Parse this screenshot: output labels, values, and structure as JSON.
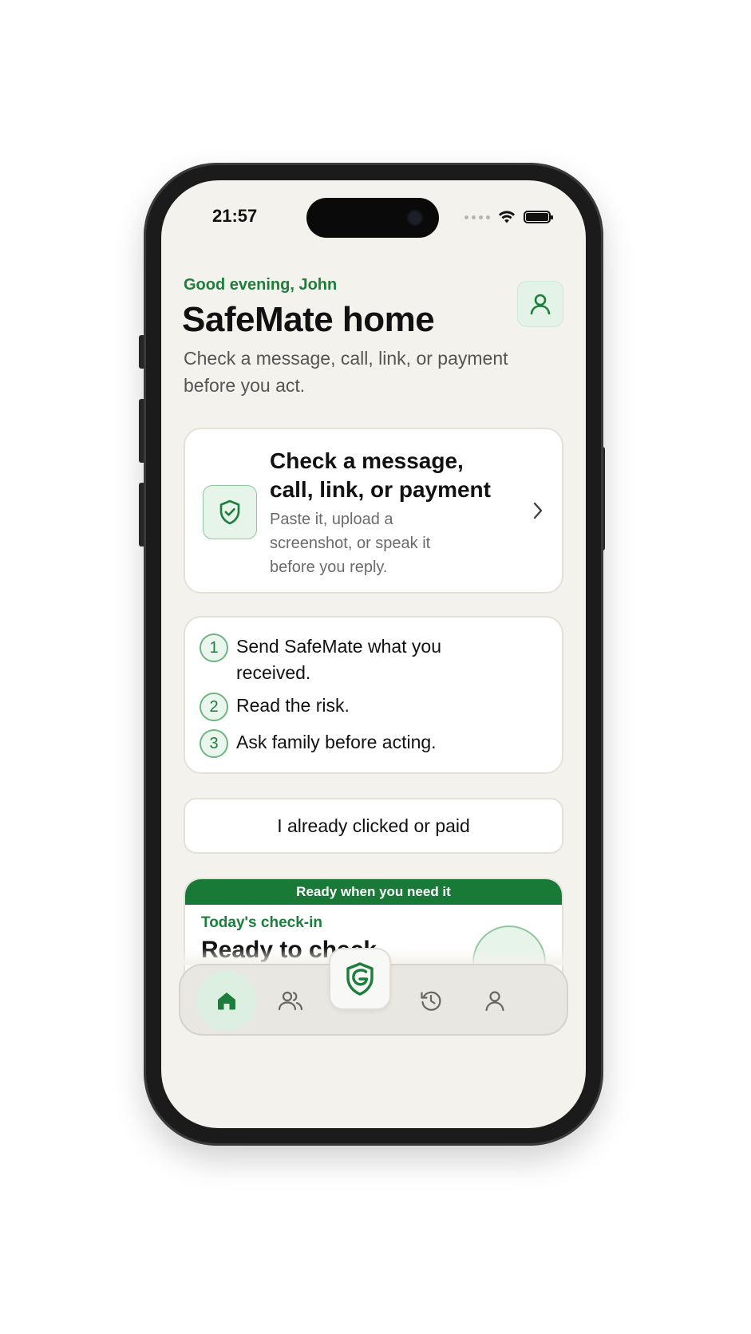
{
  "status_bar": {
    "time": "21:57"
  },
  "header": {
    "greeting": "Good evening, John",
    "title": "SafeMate home",
    "subtitle": "Check a message, call, link, or payment before you act."
  },
  "check_card": {
    "title": "Check a message, call, link, or payment",
    "description": "Paste it, upload a screenshot, or speak it before you reply."
  },
  "steps": [
    {
      "number": "1",
      "text": "Send SafeMate what you received."
    },
    {
      "number": "2",
      "text": "Read the risk."
    },
    {
      "number": "3",
      "text": "Ask family before acting."
    }
  ],
  "clicked_button": {
    "label": "I already clicked or paid"
  },
  "checkin_card": {
    "banner": "Ready when you need it",
    "label": "Today's check-in",
    "title": "Ready to check"
  },
  "tabs": {
    "home": "home-icon",
    "family": "family-icon",
    "check": "shield-check-icon",
    "history": "history-icon",
    "profile": "profile-icon"
  },
  "colors": {
    "accent": "#1b7f3b",
    "banner": "#187a36",
    "background": "#f4f2ec"
  }
}
